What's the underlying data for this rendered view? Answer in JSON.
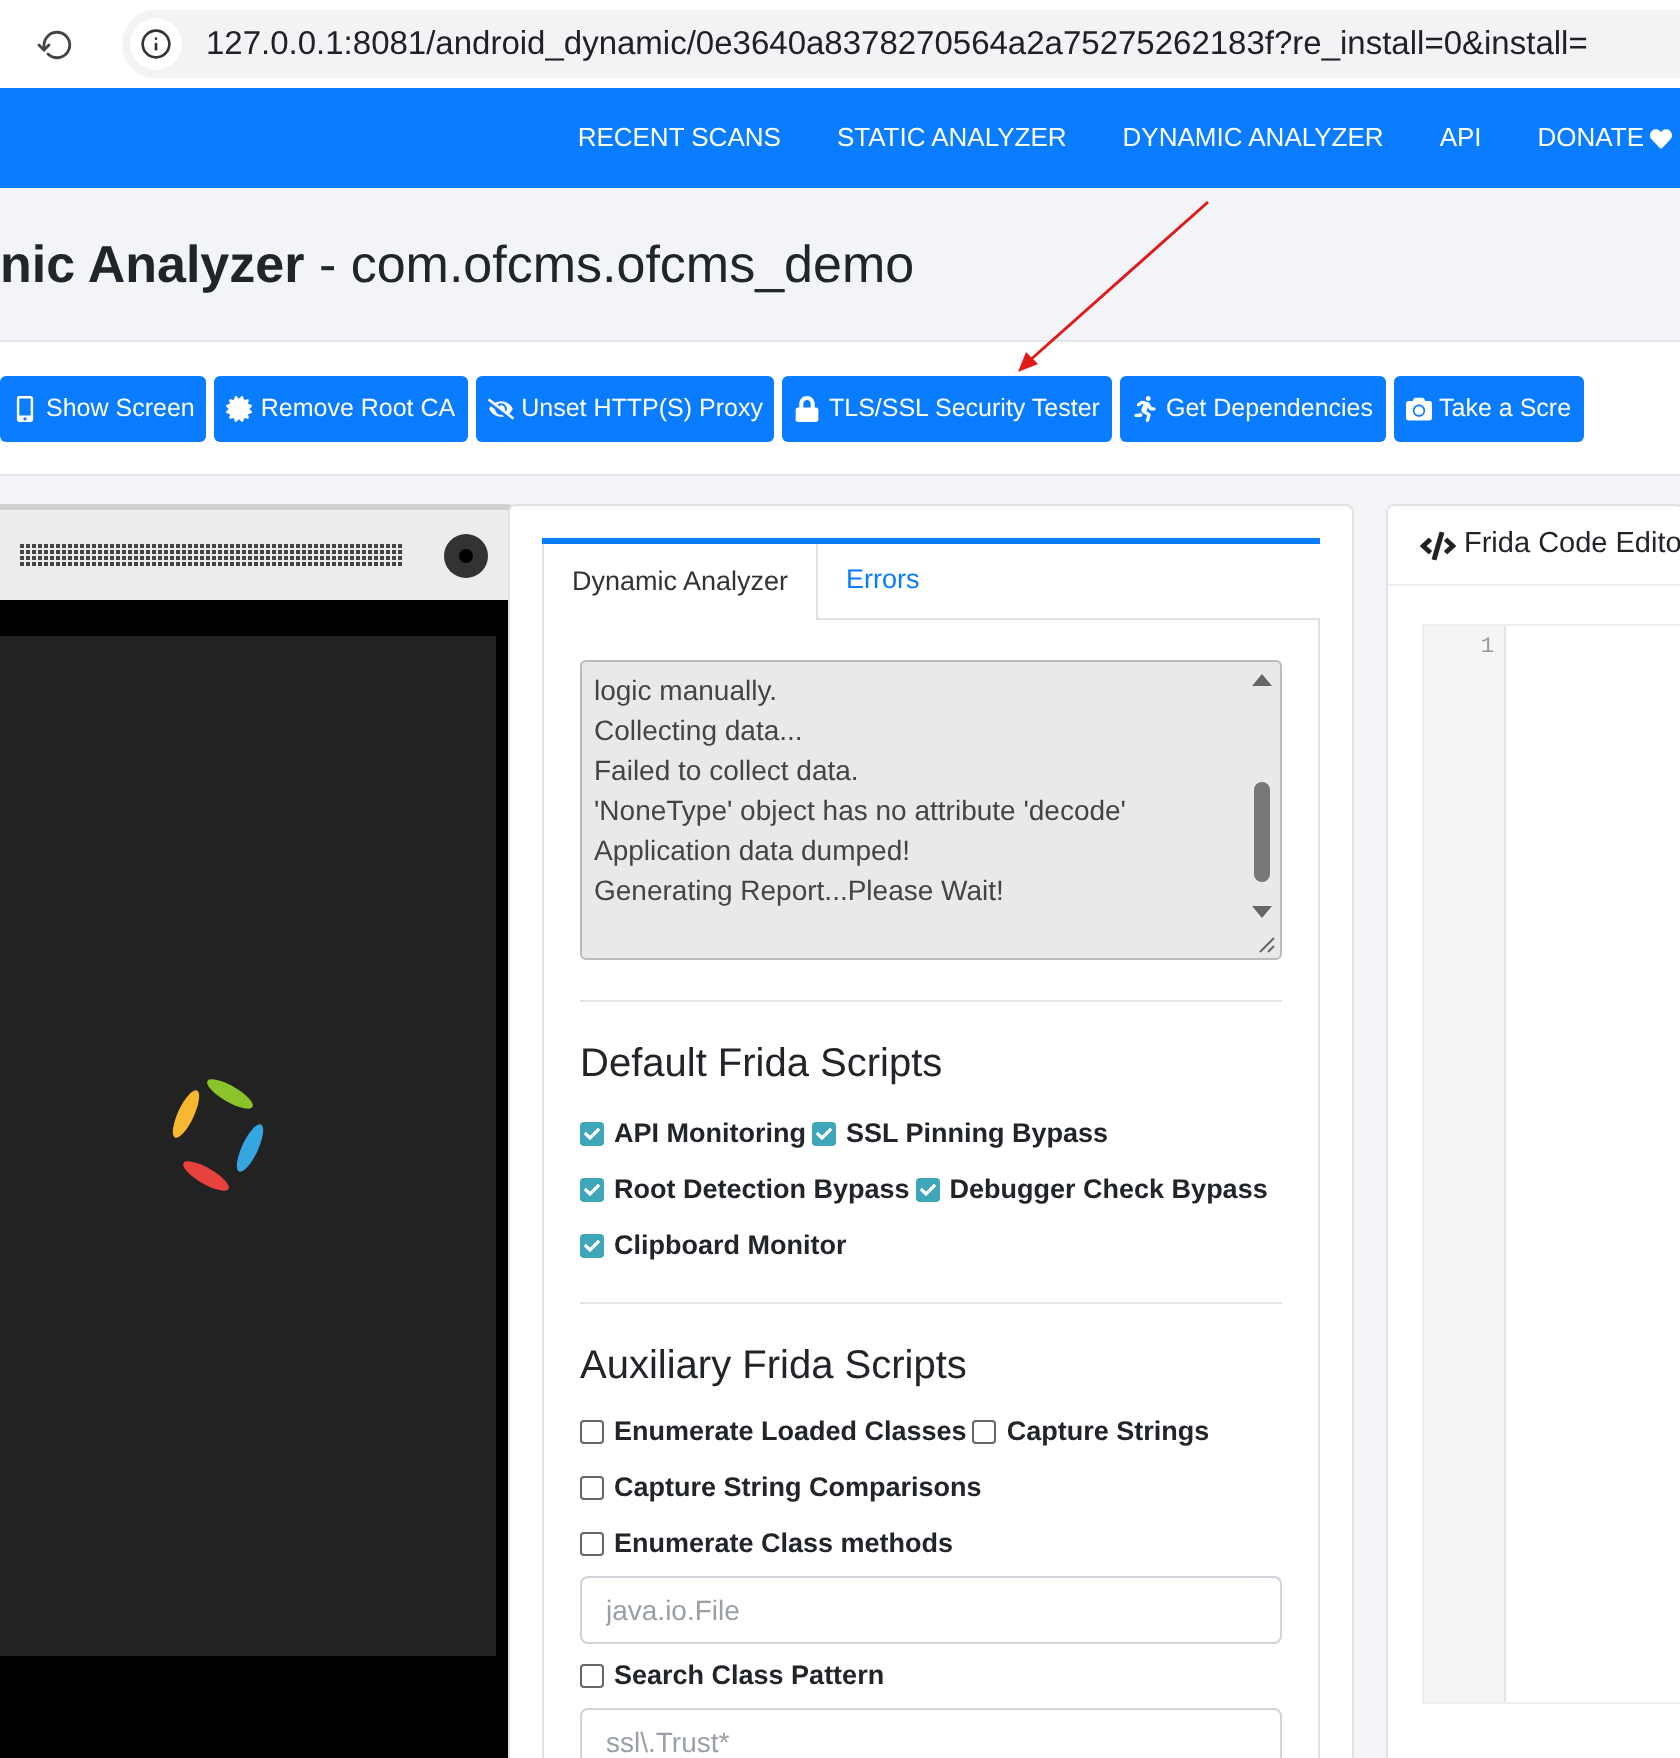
{
  "browser": {
    "url": "127.0.0.1:8081/android_dynamic/0e3640a8378270564a2a75275262183f?re_install=0&install="
  },
  "navbar": {
    "items": [
      {
        "label": "RECENT SCANS",
        "kind": "text"
      },
      {
        "label": "STATIC ANALYZER",
        "kind": "text"
      },
      {
        "label": "DYNAMIC ANALYZER",
        "kind": "text"
      },
      {
        "label": "API",
        "kind": "text"
      },
      {
        "label": "DONATE",
        "kind": "heart"
      }
    ]
  },
  "title": {
    "bold": "nic Analyzer",
    "rest": " - com.ofcms.ofcms_demo"
  },
  "actions": [
    {
      "label": "Show Screen",
      "kind": "phone"
    },
    {
      "label": "Remove Root CA",
      "kind": "certificate"
    },
    {
      "label": "Unset HTTP(S) Proxy",
      "kind": "eye-slash"
    },
    {
      "label": "TLS/SSL Security Tester",
      "kind": "lock"
    },
    {
      "label": "Get Dependencies",
      "kind": "runner"
    },
    {
      "label": "Take a Scre",
      "kind": "camera"
    }
  ],
  "tabs": [
    {
      "label": "Dynamic Analyzer",
      "selected": true
    },
    {
      "label": "Errors",
      "selected": false
    }
  ],
  "log": {
    "lines": [
      "logic manually.",
      "Collecting data...",
      "Failed to collect data.",
      "'NoneType' object has no attribute 'decode'",
      "Application data dumped!",
      "Generating Report...Please Wait!"
    ]
  },
  "default_scripts": {
    "heading": "Default Frida Scripts",
    "rows": [
      [
        {
          "kind": "checkbox",
          "label": "API Monitoring",
          "checked": true
        },
        {
          "kind": "checkbox",
          "label": "SSL Pinning Bypass",
          "checked": true
        }
      ],
      [
        {
          "kind": "checkbox",
          "label": "Root Detection Bypass",
          "checked": true
        },
        {
          "kind": "checkbox",
          "label": "Debugger Check Bypass",
          "checked": true
        }
      ],
      [
        {
          "kind": "checkbox",
          "label": "Clipboard Monitor",
          "checked": true
        }
      ]
    ]
  },
  "auxiliary_scripts": {
    "heading": "Auxiliary Frida Scripts",
    "rows": [
      [
        {
          "kind": "checkbox",
          "label": "Enumerate Loaded Classes",
          "checked": false
        },
        {
          "kind": "checkbox",
          "label": "Capture Strings",
          "checked": false
        }
      ],
      [
        {
          "kind": "checkbox",
          "label": "Capture String Comparisons",
          "checked": false
        }
      ],
      [
        {
          "kind": "checkbox",
          "label": "Enumerate Class methods",
          "checked": false
        }
      ],
      [
        {
          "kind": "input",
          "placeholder": "java.io.File"
        }
      ],
      [
        {
          "kind": "checkbox",
          "label": "Search Class Pattern",
          "checked": false
        }
      ],
      [
        {
          "kind": "input",
          "placeholder": "ssl\\.Trust*"
        }
      ]
    ]
  },
  "editor": {
    "title": "Frida Code Edito",
    "line_numbers": [
      "1"
    ]
  }
}
